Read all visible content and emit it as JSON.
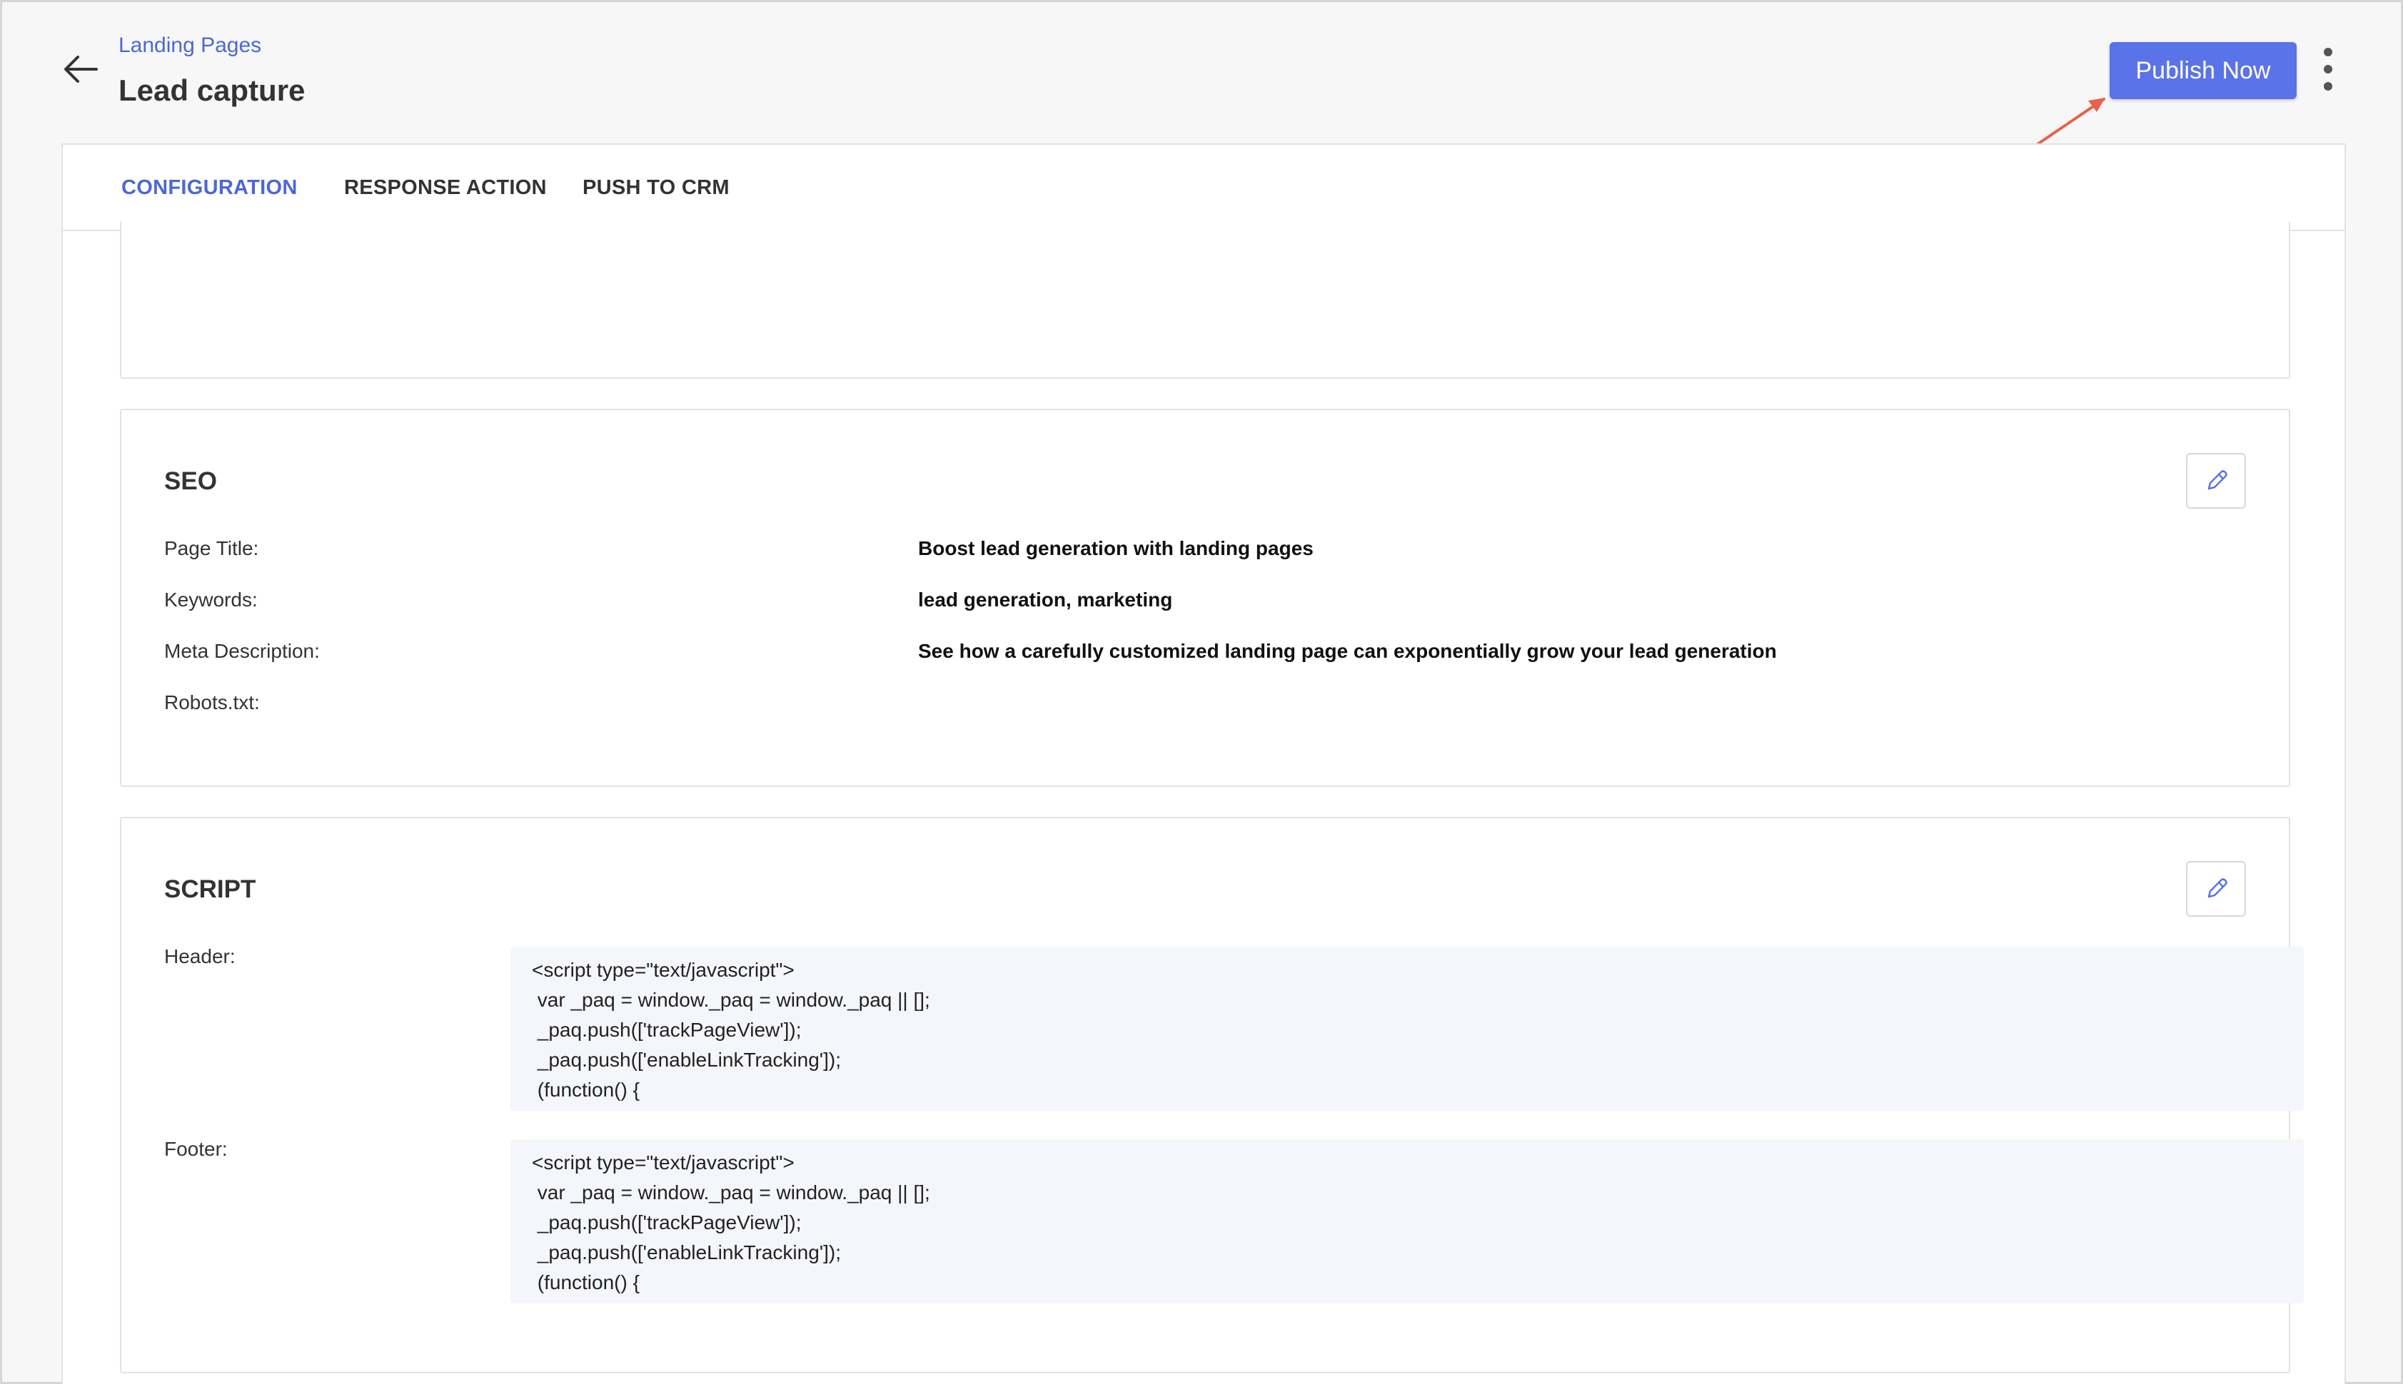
{
  "header": {
    "breadcrumb": "Landing Pages",
    "title": "Lead capture",
    "publish_label": "Publish Now"
  },
  "tabs": [
    {
      "label": "CONFIGURATION",
      "active": true
    },
    {
      "label": "RESPONSE ACTION",
      "active": false
    },
    {
      "label": "PUSH TO CRM",
      "active": false
    }
  ],
  "seo": {
    "title": "SEO",
    "fields": [
      {
        "label": "Page Title:",
        "value": "Boost lead generation with landing pages"
      },
      {
        "label": "Keywords:",
        "value": "lead generation, marketing"
      },
      {
        "label": "Meta Description:",
        "value": "See how a carefully customized landing page can exponentially grow your lead generation"
      },
      {
        "label": "Robots.txt:",
        "value": ""
      }
    ]
  },
  "script": {
    "title": "SCRIPT",
    "header_label": "Header:",
    "footer_label": "Footer:",
    "header_lines": [
      "<script type=\"text/javascript\">",
      " var _paq = window._paq = window._paq || [];",
      " _paq.push(['trackPageView']);",
      " _paq.push(['enableLinkTracking']);",
      " (function() {"
    ],
    "footer_lines": [
      "<script type=\"text/javascript\">",
      " var _paq = window._paq = window._paq || [];",
      " _paq.push(['trackPageView']);",
      " _paq.push(['enableLinkTracking']);",
      " (function() {"
    ]
  },
  "colors": {
    "accent": "#5b73e8",
    "link": "#4b68d8",
    "annotation_arrow": "#e8604c"
  },
  "icons": {
    "back": "arrow-left-icon",
    "more": "kebab-menu-icon",
    "edit": "pencil-icon"
  }
}
